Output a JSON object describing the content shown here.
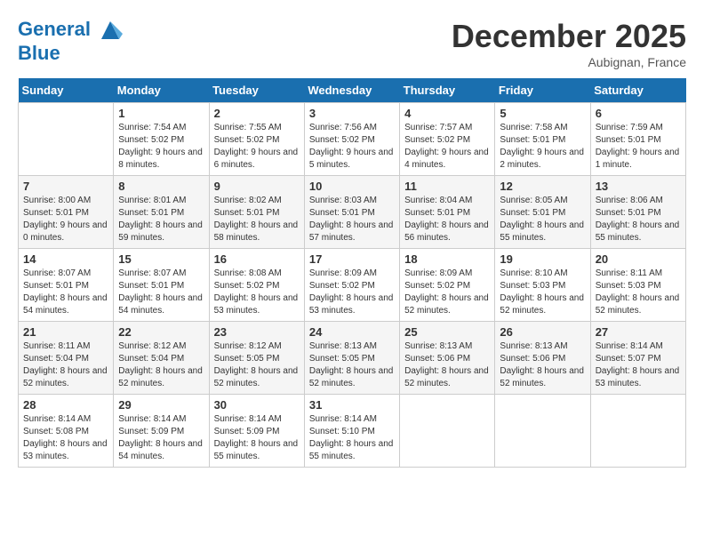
{
  "header": {
    "logo_line1": "General",
    "logo_line2": "Blue",
    "month": "December 2025",
    "location": "Aubignan, France"
  },
  "weekdays": [
    "Sunday",
    "Monday",
    "Tuesday",
    "Wednesday",
    "Thursday",
    "Friday",
    "Saturday"
  ],
  "weeks": [
    [
      {
        "day": "",
        "sunrise": "",
        "sunset": "",
        "daylight": ""
      },
      {
        "day": "1",
        "sunrise": "Sunrise: 7:54 AM",
        "sunset": "Sunset: 5:02 PM",
        "daylight": "Daylight: 9 hours and 8 minutes."
      },
      {
        "day": "2",
        "sunrise": "Sunrise: 7:55 AM",
        "sunset": "Sunset: 5:02 PM",
        "daylight": "Daylight: 9 hours and 6 minutes."
      },
      {
        "day": "3",
        "sunrise": "Sunrise: 7:56 AM",
        "sunset": "Sunset: 5:02 PM",
        "daylight": "Daylight: 9 hours and 5 minutes."
      },
      {
        "day": "4",
        "sunrise": "Sunrise: 7:57 AM",
        "sunset": "Sunset: 5:02 PM",
        "daylight": "Daylight: 9 hours and 4 minutes."
      },
      {
        "day": "5",
        "sunrise": "Sunrise: 7:58 AM",
        "sunset": "Sunset: 5:01 PM",
        "daylight": "Daylight: 9 hours and 2 minutes."
      },
      {
        "day": "6",
        "sunrise": "Sunrise: 7:59 AM",
        "sunset": "Sunset: 5:01 PM",
        "daylight": "Daylight: 9 hours and 1 minute."
      }
    ],
    [
      {
        "day": "7",
        "sunrise": "Sunrise: 8:00 AM",
        "sunset": "Sunset: 5:01 PM",
        "daylight": "Daylight: 9 hours and 0 minutes."
      },
      {
        "day": "8",
        "sunrise": "Sunrise: 8:01 AM",
        "sunset": "Sunset: 5:01 PM",
        "daylight": "Daylight: 8 hours and 59 minutes."
      },
      {
        "day": "9",
        "sunrise": "Sunrise: 8:02 AM",
        "sunset": "Sunset: 5:01 PM",
        "daylight": "Daylight: 8 hours and 58 minutes."
      },
      {
        "day": "10",
        "sunrise": "Sunrise: 8:03 AM",
        "sunset": "Sunset: 5:01 PM",
        "daylight": "Daylight: 8 hours and 57 minutes."
      },
      {
        "day": "11",
        "sunrise": "Sunrise: 8:04 AM",
        "sunset": "Sunset: 5:01 PM",
        "daylight": "Daylight: 8 hours and 56 minutes."
      },
      {
        "day": "12",
        "sunrise": "Sunrise: 8:05 AM",
        "sunset": "Sunset: 5:01 PM",
        "daylight": "Daylight: 8 hours and 55 minutes."
      },
      {
        "day": "13",
        "sunrise": "Sunrise: 8:06 AM",
        "sunset": "Sunset: 5:01 PM",
        "daylight": "Daylight: 8 hours and 55 minutes."
      }
    ],
    [
      {
        "day": "14",
        "sunrise": "Sunrise: 8:07 AM",
        "sunset": "Sunset: 5:01 PM",
        "daylight": "Daylight: 8 hours and 54 minutes."
      },
      {
        "day": "15",
        "sunrise": "Sunrise: 8:07 AM",
        "sunset": "Sunset: 5:01 PM",
        "daylight": "Daylight: 8 hours and 54 minutes."
      },
      {
        "day": "16",
        "sunrise": "Sunrise: 8:08 AM",
        "sunset": "Sunset: 5:02 PM",
        "daylight": "Daylight: 8 hours and 53 minutes."
      },
      {
        "day": "17",
        "sunrise": "Sunrise: 8:09 AM",
        "sunset": "Sunset: 5:02 PM",
        "daylight": "Daylight: 8 hours and 53 minutes."
      },
      {
        "day": "18",
        "sunrise": "Sunrise: 8:09 AM",
        "sunset": "Sunset: 5:02 PM",
        "daylight": "Daylight: 8 hours and 52 minutes."
      },
      {
        "day": "19",
        "sunrise": "Sunrise: 8:10 AM",
        "sunset": "Sunset: 5:03 PM",
        "daylight": "Daylight: 8 hours and 52 minutes."
      },
      {
        "day": "20",
        "sunrise": "Sunrise: 8:11 AM",
        "sunset": "Sunset: 5:03 PM",
        "daylight": "Daylight: 8 hours and 52 minutes."
      }
    ],
    [
      {
        "day": "21",
        "sunrise": "Sunrise: 8:11 AM",
        "sunset": "Sunset: 5:04 PM",
        "daylight": "Daylight: 8 hours and 52 minutes."
      },
      {
        "day": "22",
        "sunrise": "Sunrise: 8:12 AM",
        "sunset": "Sunset: 5:04 PM",
        "daylight": "Daylight: 8 hours and 52 minutes."
      },
      {
        "day": "23",
        "sunrise": "Sunrise: 8:12 AM",
        "sunset": "Sunset: 5:05 PM",
        "daylight": "Daylight: 8 hours and 52 minutes."
      },
      {
        "day": "24",
        "sunrise": "Sunrise: 8:13 AM",
        "sunset": "Sunset: 5:05 PM",
        "daylight": "Daylight: 8 hours and 52 minutes."
      },
      {
        "day": "25",
        "sunrise": "Sunrise: 8:13 AM",
        "sunset": "Sunset: 5:06 PM",
        "daylight": "Daylight: 8 hours and 52 minutes."
      },
      {
        "day": "26",
        "sunrise": "Sunrise: 8:13 AM",
        "sunset": "Sunset: 5:06 PM",
        "daylight": "Daylight: 8 hours and 52 minutes."
      },
      {
        "day": "27",
        "sunrise": "Sunrise: 8:14 AM",
        "sunset": "Sunset: 5:07 PM",
        "daylight": "Daylight: 8 hours and 53 minutes."
      }
    ],
    [
      {
        "day": "28",
        "sunrise": "Sunrise: 8:14 AM",
        "sunset": "Sunset: 5:08 PM",
        "daylight": "Daylight: 8 hours and 53 minutes."
      },
      {
        "day": "29",
        "sunrise": "Sunrise: 8:14 AM",
        "sunset": "Sunset: 5:09 PM",
        "daylight": "Daylight: 8 hours and 54 minutes."
      },
      {
        "day": "30",
        "sunrise": "Sunrise: 8:14 AM",
        "sunset": "Sunset: 5:09 PM",
        "daylight": "Daylight: 8 hours and 55 minutes."
      },
      {
        "day": "31",
        "sunrise": "Sunrise: 8:14 AM",
        "sunset": "Sunset: 5:10 PM",
        "daylight": "Daylight: 8 hours and 55 minutes."
      },
      {
        "day": "",
        "sunrise": "",
        "sunset": "",
        "daylight": ""
      },
      {
        "day": "",
        "sunrise": "",
        "sunset": "",
        "daylight": ""
      },
      {
        "day": "",
        "sunrise": "",
        "sunset": "",
        "daylight": ""
      }
    ]
  ]
}
